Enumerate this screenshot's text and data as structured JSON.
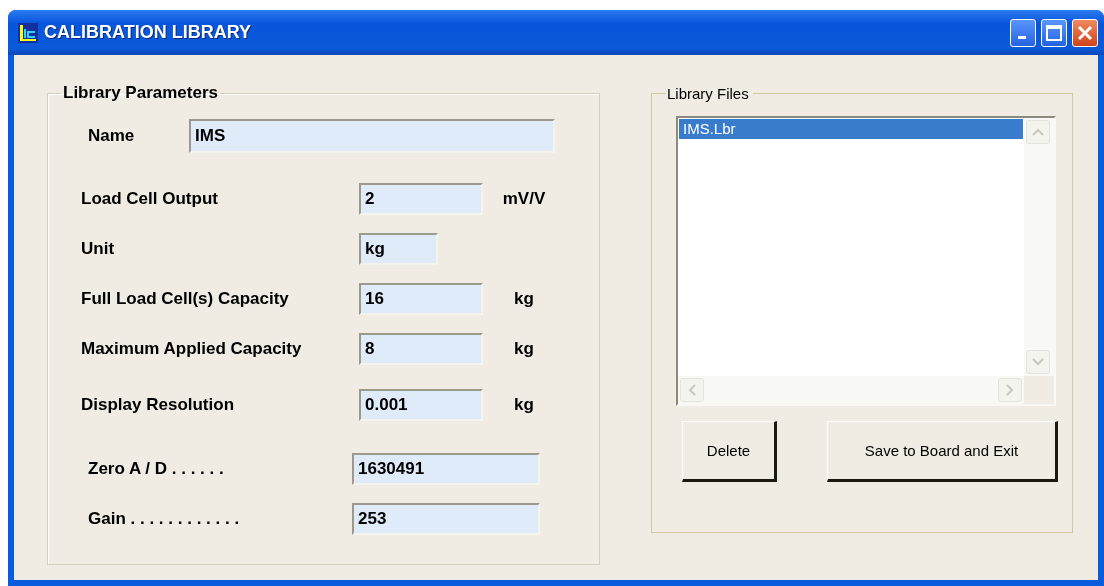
{
  "window": {
    "title": "CALIBRATION LIBRARY"
  },
  "library_parameters": {
    "title": "Library Parameters",
    "fields": [
      {
        "kind": "name",
        "label": "Name",
        "value": "IMS"
      },
      {
        "kind": "standard",
        "label": "Load Cell Output",
        "value": "2",
        "unit": "mV/V"
      },
      {
        "kind": "short",
        "label": "Unit",
        "value": "kg"
      },
      {
        "kind": "standard",
        "label": "Full Load Cell(s) Capacity",
        "value": "16",
        "unit": "kg"
      },
      {
        "kind": "standard",
        "label": "Maximum Applied Capacity",
        "value": "8",
        "unit": "kg"
      },
      {
        "kind": "standard",
        "label": "Display Resolution",
        "value": "0.001",
        "unit": "kg"
      },
      {
        "kind": "calibration",
        "label": "Zero A / D . . . . . .",
        "value": "1630491"
      },
      {
        "kind": "calibration",
        "label": "Gain . . . . . . . . . . . .",
        "value": "253"
      }
    ]
  },
  "library_files": {
    "title": "Library Files",
    "items": [
      {
        "label": "IMS.Lbr",
        "selected": true
      }
    ],
    "buttons": [
      "Delete",
      "Save to Board and Exit"
    ]
  }
}
